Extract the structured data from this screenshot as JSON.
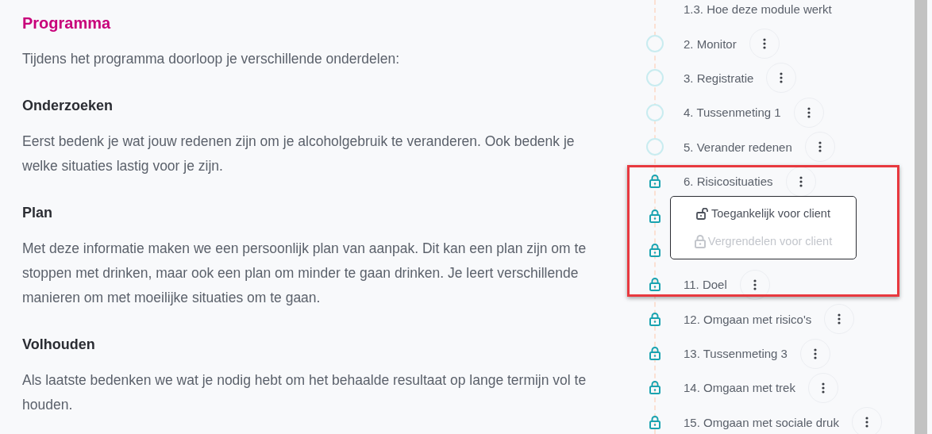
{
  "content": {
    "title": "Programma",
    "intro": "Tijdens het programma doorloop je verschillende onderdelen:",
    "sections": [
      {
        "heading": "Onderzoeken",
        "text": "Eerst bedenk je wat jouw redenen zijn om je alcoholgebruik te veranderen. Ook bedenk je welke situaties lastig voor je zijn."
      },
      {
        "heading": "Plan",
        "text": "Met deze informatie maken we een persoonlijk plan van aanpak. Dit kan een plan zijn om te stoppen met drinken, maar ook een plan om minder te gaan drinken. Je leert verschillende manieren om met moeilijke situaties om te gaan."
      },
      {
        "heading": "Volhouden",
        "text": "Als laatste bedenken we wat je nodig hebt om het behaalde resultaat op lange termijn vol te houden."
      }
    ]
  },
  "modules": {
    "items": [
      {
        "label": "1.3. Hoe deze module werkt",
        "kind": "subitem",
        "highlighted": false
      },
      {
        "label": "2. Monitor",
        "kind": "open",
        "highlighted": false
      },
      {
        "label": "3. Registratie",
        "kind": "open",
        "highlighted": false
      },
      {
        "label": "4. Tussenmeting 1",
        "kind": "open",
        "highlighted": false
      },
      {
        "label": "5. Verander redenen",
        "kind": "open",
        "highlighted": false
      },
      {
        "label": "6. Risicosituaties",
        "kind": "locked",
        "highlighted": true,
        "menu": [
          {
            "label": "Toegankelijk voor client",
            "kind": "unlock",
            "disabled": false
          },
          {
            "label": "Vergrendelen voor client",
            "kind": "lock",
            "disabled": true
          }
        ]
      },
      {
        "kind": "locked"
      },
      {
        "kind": "locked"
      },
      {
        "label": "11. Doel",
        "kind": "locked",
        "highlighted": true
      },
      {
        "label": "12. Omgaan met risico's",
        "kind": "locked",
        "highlighted": false
      },
      {
        "label": "13. Tussenmeting 3",
        "kind": "locked",
        "highlighted": false
      },
      {
        "label": "14. Omgaan met trek",
        "kind": "locked",
        "highlighted": false
      },
      {
        "label": "15. Omgaan met sociale druk",
        "kind": "locked",
        "highlighted": false
      }
    ]
  }
}
